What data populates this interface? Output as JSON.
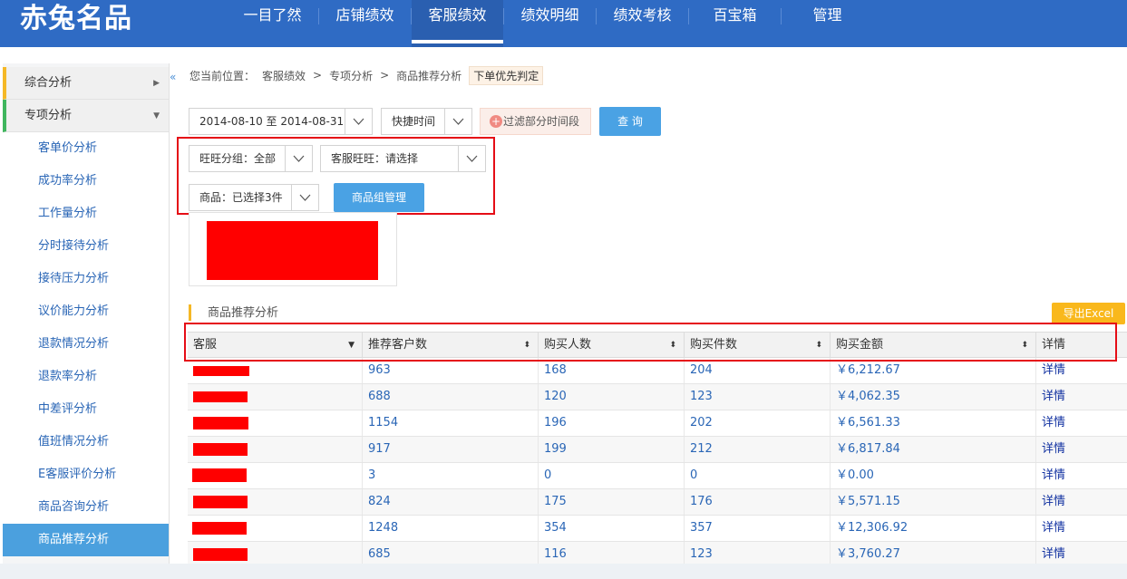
{
  "app": {
    "logo": "赤兔名品"
  },
  "nav": {
    "items": [
      {
        "label": "一目了然"
      },
      {
        "label": "店铺绩效"
      },
      {
        "label": "客服绩效",
        "active": true
      },
      {
        "label": "绩效明细"
      },
      {
        "label": "绩效考核"
      },
      {
        "label": "百宝箱"
      },
      {
        "label": "管理"
      }
    ]
  },
  "sidebar": {
    "group1": "综合分析",
    "group2": "专项分析",
    "items": [
      "客单价分析",
      "成功率分析",
      "工作量分析",
      "分时接待分析",
      "接待压力分析",
      "议价能力分析",
      "退款情况分析",
      "退款率分析",
      "中差评分析",
      "值班情况分析",
      "E客服评价分析",
      "商品咨询分析",
      "商品推荐分析"
    ],
    "active_index": 12,
    "collapse_glyph": "«"
  },
  "breadcrumb": {
    "prefix": "您当前位置：",
    "level1": "客服绩效",
    "level2": "专项分析",
    "level3": "商品推荐分析",
    "tag": "下单优先判定",
    "separator": ">"
  },
  "filters": {
    "date_range": "2014-08-10 至 2014-08-31",
    "quick_time": "快捷时间",
    "filter_time": "过滤部分时间段",
    "query": "查 询",
    "wangwang_group": "旺旺分组：全部",
    "cs_wangwang": "客服旺旺：请选择",
    "product": "商品：已选择3件",
    "product_group_btn": "商品组管理"
  },
  "section": {
    "title": "商品推荐分析",
    "export": "导出Excel"
  },
  "table": {
    "headers": [
      "客服",
      "推荐客户数",
      "购买人数",
      "购买件数",
      "购买金额",
      "详情"
    ],
    "rows": [
      [
        "963",
        "168",
        "204",
        "￥6,212.67",
        "详情"
      ],
      [
        "688",
        "120",
        "123",
        "￥4,062.35",
        "详情"
      ],
      [
        "1154",
        "196",
        "202",
        "￥6,561.33",
        "详情"
      ],
      [
        "917",
        "199",
        "212",
        "￥6,817.84",
        "详情"
      ],
      [
        "3",
        "0",
        "0",
        "￥0.00",
        "详情"
      ],
      [
        "824",
        "175",
        "176",
        "￥5,571.15",
        "详情"
      ],
      [
        "1248",
        "354",
        "357",
        "￥12,306.92",
        "详情"
      ],
      [
        "685",
        "116",
        "123",
        "￥3,760.27",
        "详情"
      ]
    ]
  },
  "colors": {
    "brand": "#2f6bc4",
    "highlight": "#e50d16",
    "accent": "#4aa2e4"
  }
}
